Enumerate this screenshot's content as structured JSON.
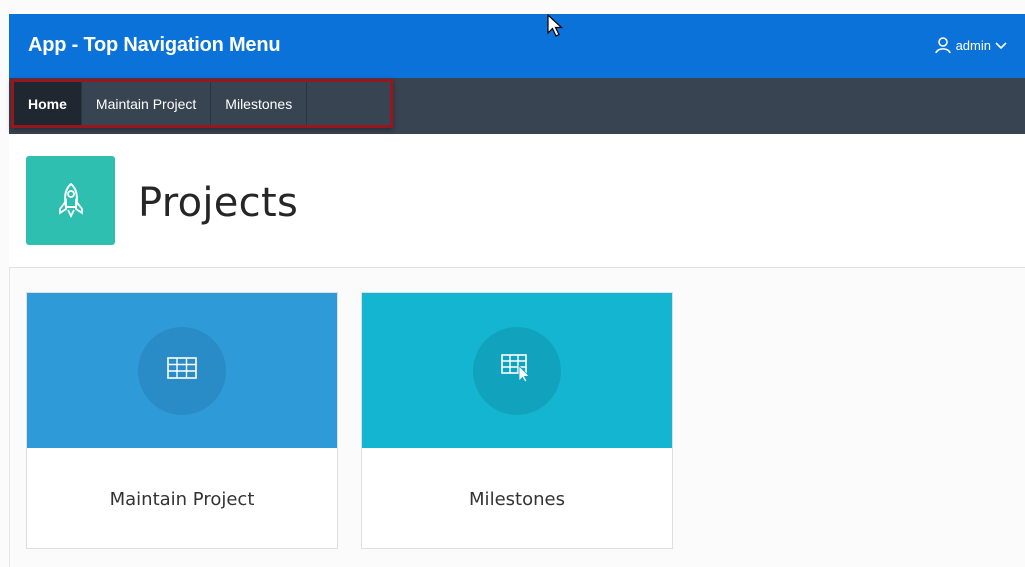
{
  "app": {
    "title": "App - Top Navigation Menu",
    "user": {
      "name": "admin",
      "icon": "user-icon",
      "caret_icon": "chevron-down-icon"
    }
  },
  "nav": {
    "items": [
      {
        "label": "Home",
        "active": true
      },
      {
        "label": "Maintain Project",
        "active": false
      },
      {
        "label": "Milestones",
        "active": false
      }
    ]
  },
  "page": {
    "title": "Projects",
    "icon": "rocket-icon"
  },
  "cards": [
    {
      "label": "Maintain Project",
      "icon": "table-icon",
      "color": "#2f9ad8",
      "circle_color": "#2a8cc6"
    },
    {
      "label": "Milestones",
      "icon": "table-pointer-icon",
      "color": "#14b5d1",
      "circle_color": "#11a3bd"
    }
  ],
  "colors": {
    "header": "#0b72d9",
    "nav": "#384451",
    "highlight_outline": "#98161d",
    "page_icon": "#2ebfb0"
  }
}
